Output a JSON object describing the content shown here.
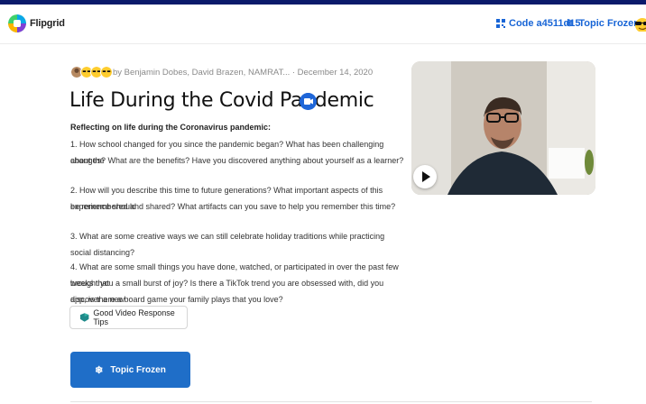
{
  "topbar": {
    "logo_text": "Flipgrid",
    "code_label": "Code a4511d15",
    "frozen_label": "Topic Frozen"
  },
  "topic": {
    "meta": "by Benjamin Dobes, David Brazen, NAMRAT...  · December 14, 2020",
    "title": "Life During the Covid Pandemic",
    "heading": "Reflecting on life during the Coronavirus pandemic:",
    "questions": [
      "1.  How school changed for you since the pandemic began? What has been challenging about the",
      "changes? What are the benefits? Have you discovered anything about yourself as a learner?",
      "2.  How will you describe this time to future generations? What important aspects of this experience should",
      "be remembered and shared? What artifacts can you save to help you remember this time?",
      "3.  What are some creative ways we can still celebrate holiday traditions while practicing social distancing?",
      "4.  What are some small things you have done, watched, or participated in over the past few weeks that",
      "brought you a small burst of joy? Is there a TikTok trend you are obsessed with, did you discover a new",
      "app, is there a board game your family plays that you love?"
    ]
  },
  "buttons": {
    "tips_label": "Good Video Response Tips",
    "frozen_label": "Topic Frozen"
  },
  "icons": {
    "logo": "flipgrid-logo",
    "code": "qr-code-icon",
    "frozen": "snowflake-icon",
    "user": "sunglasses-emoji-icon",
    "badge": "video-badge-icon",
    "tips": "tips-icon",
    "play": "play-icon"
  },
  "colors": {
    "accent": "#1865d6",
    "frozen_button": "#1f6ec8",
    "outer_border": "#0b1a6b"
  }
}
